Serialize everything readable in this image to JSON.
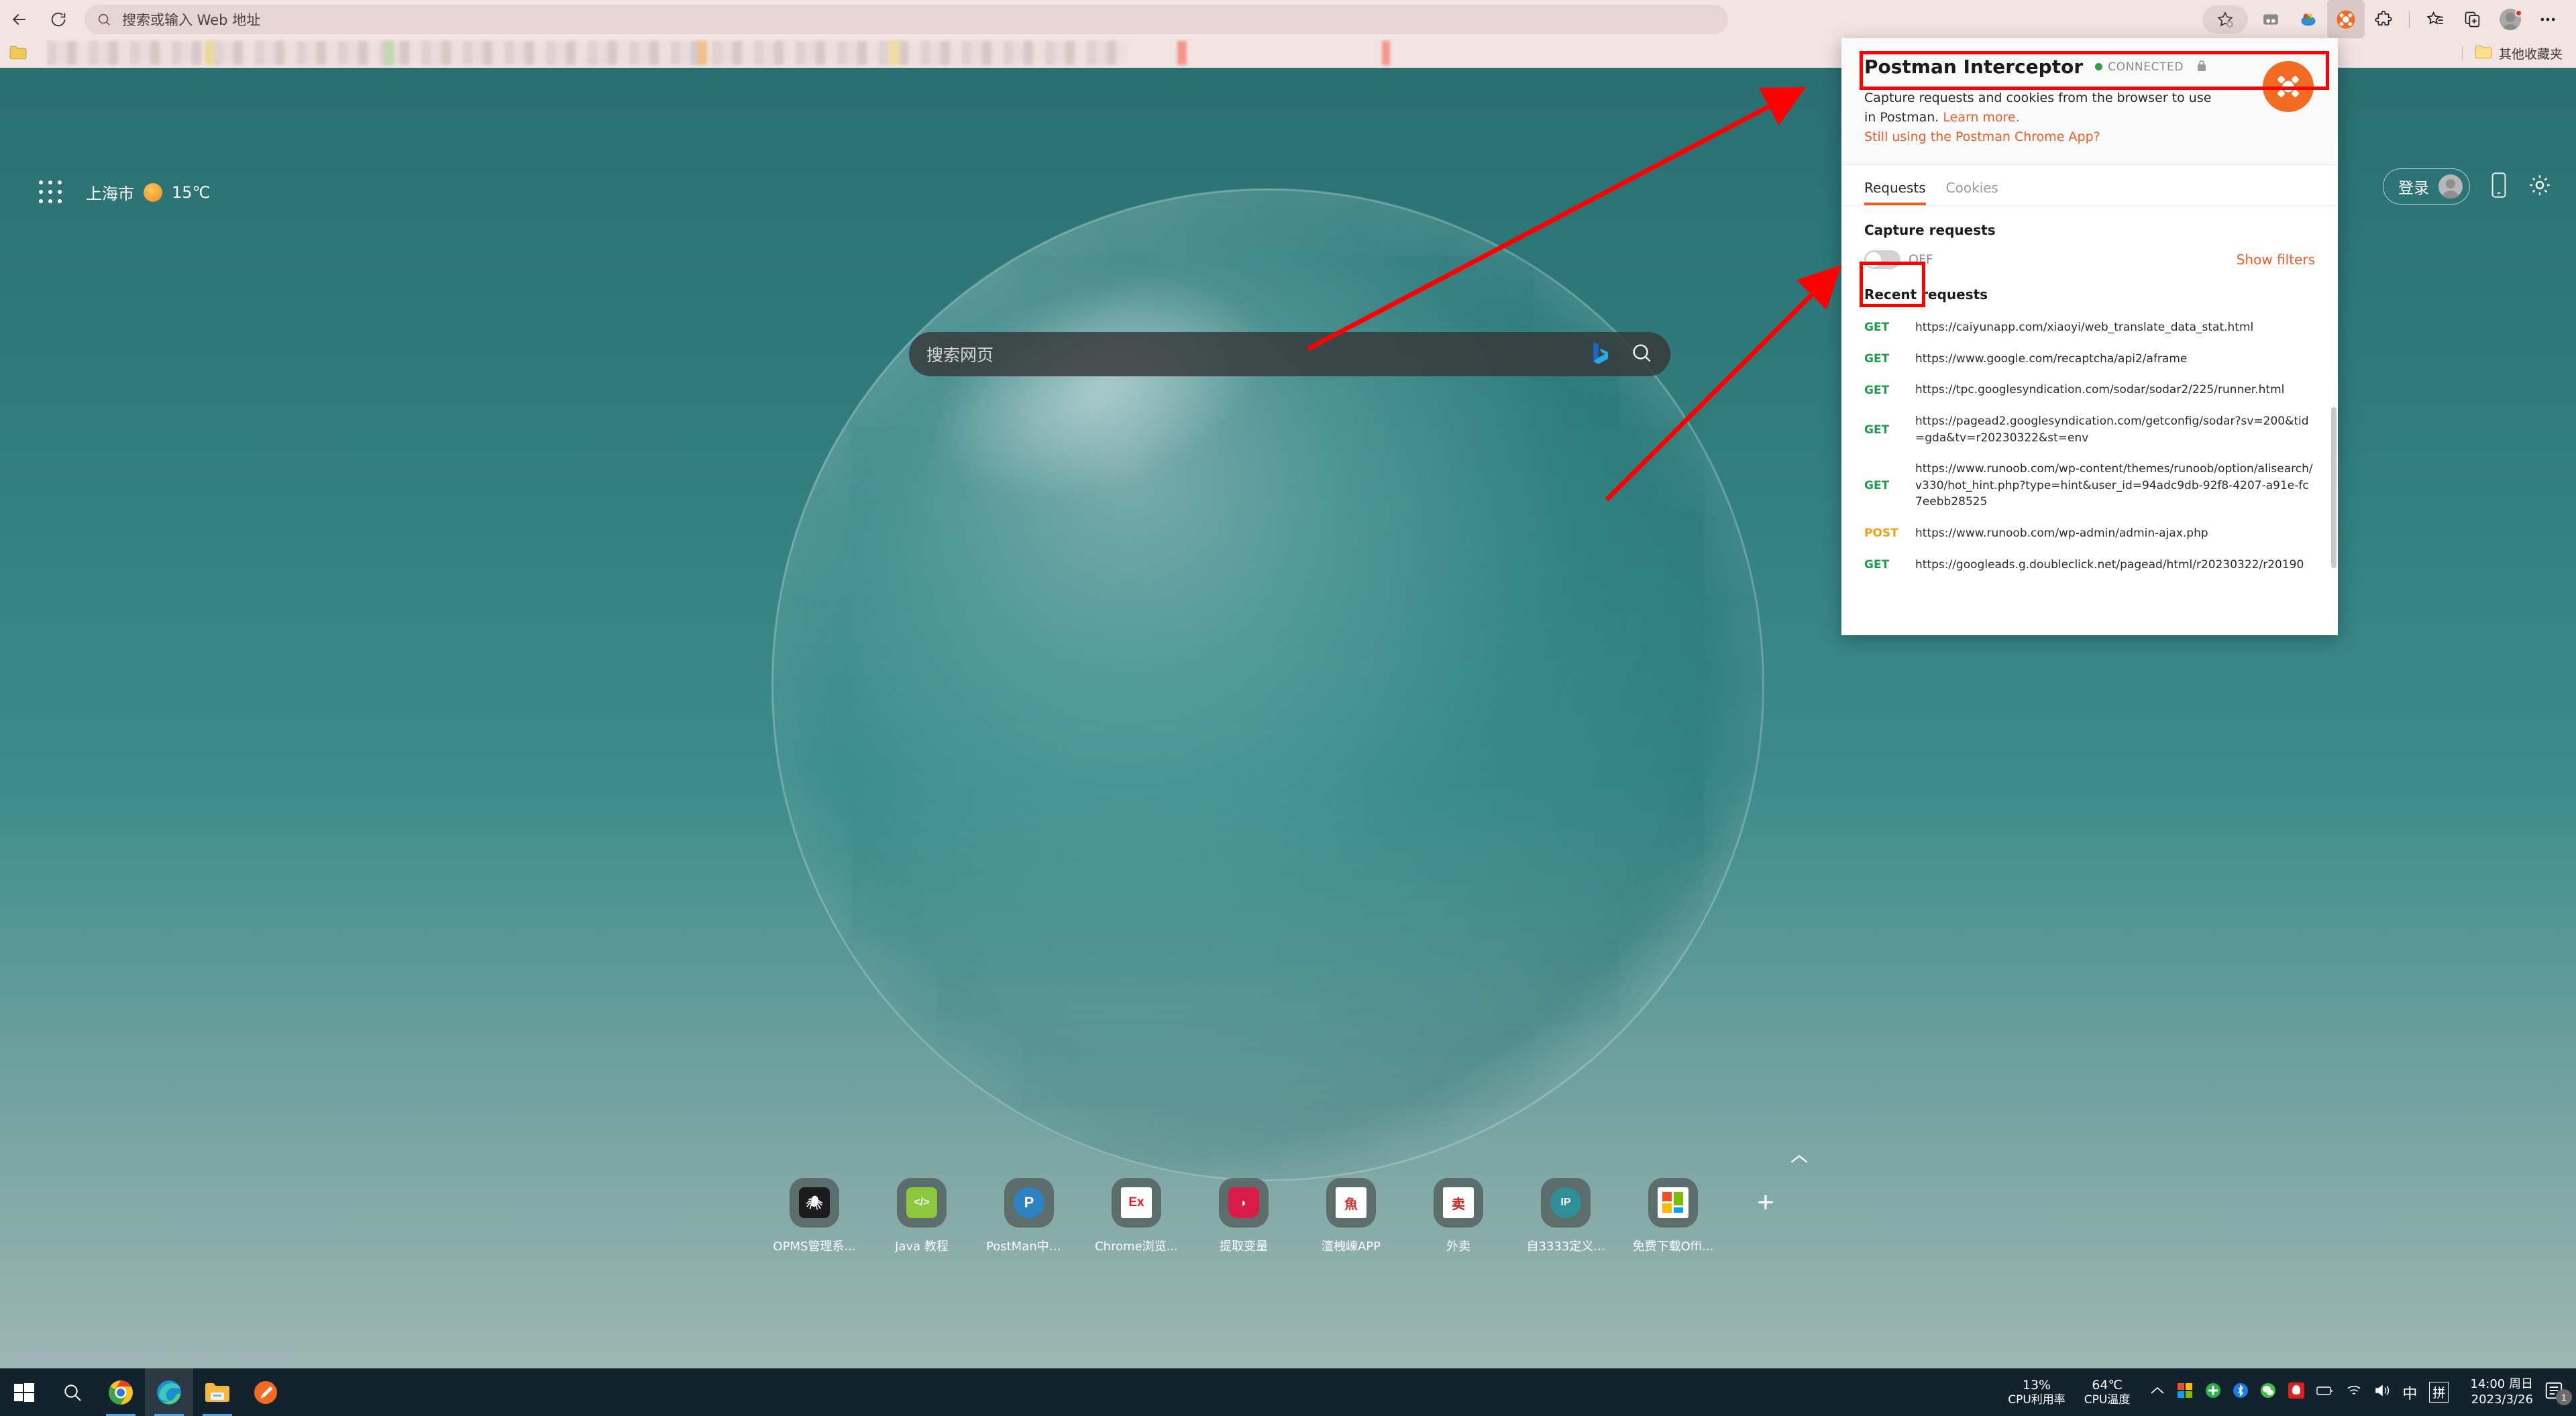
{
  "browser": {
    "back_icon": "back-arrow-icon",
    "reload_icon": "reload-icon",
    "omnibox": {
      "placeholder": "搜索或输入 Web 地址",
      "value": "",
      "search_icon": "search-icon"
    },
    "toolbar_right": {
      "add_favorite_label": "",
      "icons": [
        "split-screen-icon",
        "collections-icon",
        "postman-interceptor-extension-icon",
        "extensions-puzzle-icon",
        "favorites-list-icon",
        "add-tab-to-collection-icon",
        "profile-avatar-icon",
        "settings-more-icon"
      ]
    },
    "bookmarks_bar": {
      "other_favorites_label": "其他收藏夹",
      "folder_icon": "folder-icon"
    }
  },
  "newtab": {
    "apps_grid_icon": "apps-grid-icon",
    "weather": {
      "city": "上海市",
      "condition_icon": "sun-icon",
      "temperature": "15℃"
    },
    "account": {
      "sign_in_label": "登录",
      "avatar_icon": "avatar-icon",
      "mobile_icon": "mobile-phone-icon",
      "settings_icon": "gear-icon"
    },
    "search": {
      "placeholder": "搜索网页",
      "value": "",
      "bing_icon": "bing-logo-icon",
      "search_icon": "search-icon"
    },
    "shortcuts": [
      {
        "label": "OPMS管理系...",
        "glyph": "🕷",
        "bg": "#1c1c1c",
        "fg": "#ffffff",
        "icon_name": "opms-spider-icon"
      },
      {
        "label": "Java 教程",
        "glyph": "</>",
        "bg": "#8dc63f",
        "fg": "#ffffff",
        "icon_name": "java-tutorial-icon"
      },
      {
        "label": "PostMan中文...",
        "glyph": "P",
        "bg": "#2b83c4",
        "fg": "#ffffff",
        "icon_name": "postman-cn-icon"
      },
      {
        "label": "Chrome浏览...",
        "glyph": "Ex",
        "bg": "#ffffff",
        "fg": "#e02020",
        "icon_name": "chrome-extension-icon"
      },
      {
        "label": "提取变量",
        "glyph": "◗",
        "bg": "#d81b48",
        "fg": "#ffffff",
        "icon_name": "extract-variable-icon"
      },
      {
        "label": "澶栧崠APP",
        "glyph": "魚",
        "bg": "#ffffff",
        "fg": "#e03030",
        "icon_name": "waimai-app-icon"
      },
      {
        "label": "外卖",
        "glyph": "卖",
        "bg": "#ffffff",
        "fg": "#d02020",
        "icon_name": "takeout-icon"
      },
      {
        "label": "自3333定义...",
        "glyph": "IP",
        "bg": "#2f8f96",
        "fg": "#ffffff",
        "icon_name": "custom-ip-icon"
      },
      {
        "label": "免费下载Offi...",
        "glyph": "▦",
        "bg": "#ffffff",
        "fg": "#f25022",
        "icon_name": "office-download-icon"
      }
    ],
    "add_shortcut_label": "+",
    "collapse_icon": "chevron-up-icon",
    "footer_license": "增值电信业务经营许可证: 合字B2-20090007"
  },
  "popup": {
    "title": "Postman Interceptor",
    "status": "CONNECTED",
    "status_color": "#2ea043",
    "lock_icon": "lock-icon",
    "logo_icon": "postman-logo-icon",
    "description_prefix": "Capture requests and cookies from the browser to use in Postman. ",
    "learn_more": "Learn more.",
    "chrome_app_link": "Still using the Postman Chrome App?",
    "tabs": [
      {
        "label": "Requests",
        "active": true
      },
      {
        "label": "Cookies",
        "active": false
      }
    ],
    "capture_section_title": "Capture requests",
    "capture_toggle_state": "OFF",
    "show_filters_label": "Show filters",
    "recent_title": "Recent requests",
    "accent_color": "#ef5b25",
    "requests": [
      {
        "method": "GET",
        "url": "https://caiyunapp.com/xiaoyi/web_translate_data_stat.html"
      },
      {
        "method": "GET",
        "url": "https://www.google.com/recaptcha/api2/aframe"
      },
      {
        "method": "GET",
        "url": "https://tpc.googlesyndication.com/sodar/sodar2/225/runner.html"
      },
      {
        "method": "GET",
        "url": "https://pagead2.googlesyndication.com/getconfig/sodar?sv=200&tid=gda&tv=r20230322&st=env"
      },
      {
        "method": "GET",
        "url": "https://www.runoob.com/wp-content/themes/runoob/option/alisearch/v330/hot_hint.php?type=hint&user_id=94adc9db-92f8-4207-a91e-fc7eebb28525"
      },
      {
        "method": "POST",
        "url": "https://www.runoob.com/wp-admin/admin-ajax.php"
      },
      {
        "method": "GET",
        "url": "https://googleads.g.doubleclick.net/pagead/html/r20230322/r20190"
      }
    ]
  },
  "annotations": {
    "color": "#ff0000",
    "highlight_title": "Postman Interceptor title highlight",
    "highlight_toggle": "Capture requests toggle highlight",
    "arrow_1": "arrow pointing to title highlight",
    "arrow_2": "arrow pointing to capture toggle"
  },
  "taskbar": {
    "items": [
      {
        "name": "start-button",
        "icon": "windows-logo-icon"
      },
      {
        "name": "search-button",
        "icon": "search-icon"
      },
      {
        "name": "chrome-taskbar-button",
        "icon": "chrome-icon"
      },
      {
        "name": "edge-taskbar-button",
        "icon": "edge-icon"
      },
      {
        "name": "file-explorer-taskbar-button",
        "icon": "folder-icon"
      },
      {
        "name": "postman-taskbar-button",
        "icon": "postman-icon"
      }
    ],
    "tray": {
      "cpu_usage_value": "13%",
      "cpu_usage_label": "CPU利用率",
      "cpu_temp_value": "64℃",
      "cpu_temp_label": "CPU温度",
      "overflow_icon": "chevron-up-icon",
      "icons": [
        "windows-security-icon",
        "360-shield-icon",
        "bluetooth-icon",
        "wechat-icon",
        "qq-icon",
        "battery-icon",
        "wifi-icon",
        "volume-icon"
      ],
      "ime_mode": "中",
      "ime_pinyin": "拼",
      "time": "14:00 周日",
      "date": "2023/3/26",
      "notification_count": "1",
      "notification_icon": "notification-icon"
    }
  }
}
